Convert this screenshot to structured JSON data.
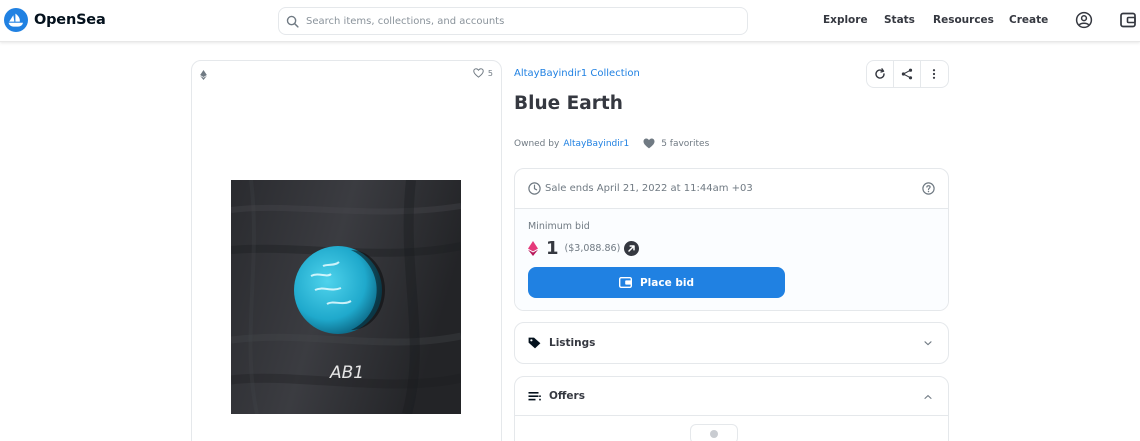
{
  "header": {
    "brand": "OpenSea",
    "search_placeholder": "Search items, collections, and accounts",
    "nav": [
      "Explore",
      "Stats",
      "Resources",
      "Create"
    ],
    "icons": [
      "opensea-logo-icon",
      "search-icon",
      "account-icon",
      "wallet-icon"
    ]
  },
  "asset": {
    "favorites_count": "5",
    "collection": "AltayBayindir1 Collection",
    "title": "Blue Earth",
    "owned_by_label": "Owned by",
    "owner": "AltayBayindir1",
    "favorites_label": "5 favorites",
    "artwork_signature": "AB1",
    "tool_icons": [
      "refresh-icon",
      "share-icon",
      "more-icon"
    ]
  },
  "sale": {
    "ends_text": "Sale ends April 21, 2022 at 11:44am +03",
    "min_bid_label": "Minimum bid",
    "price": "1",
    "usd": "($3,088.86)",
    "place_bid_label": "Place bid"
  },
  "panels": {
    "listings_label": "Listings",
    "offers_label": "Offers"
  },
  "colors": {
    "accent": "#2081e2",
    "text": "#353840",
    "muted": "#707a83",
    "border": "#e5e8eb",
    "eth_pink": "#e53a7b",
    "planet": "#28b7d6"
  }
}
